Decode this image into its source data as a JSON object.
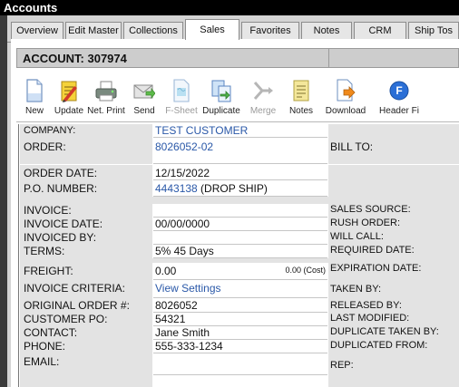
{
  "title": "Accounts",
  "tabs": [
    "Overview",
    "Edit Master",
    "Collections",
    "Sales",
    "Favorites",
    "Notes",
    "CRM",
    "Ship Tos"
  ],
  "active_tab": "Sales",
  "account_title": "ACCOUNT: 307974",
  "toolbar": {
    "new": "New",
    "update": "Update",
    "net_print": "Net. Print",
    "send": "Send",
    "fsheet": "F-Sheet",
    "duplicate": "Duplicate",
    "merge": "Merge",
    "notes": "Notes",
    "download": "Download",
    "header": "Header Fi"
  },
  "form": {
    "company_label": "COMPANY:",
    "company_value": "TEST CUSTOMER",
    "order_label": "ORDER:",
    "order_value": "8026052-02",
    "bill_to_label": "BILL TO:",
    "order_date_label": "ORDER DATE:",
    "order_date_value": "12/15/2022",
    "po_label": "P.O. NUMBER:",
    "po_value_link": "4443138",
    "po_value_text": " (DROP SHIP)",
    "invoice_label": "INVOICE:",
    "invoice_value": "",
    "sales_source_label": "SALES SOURCE:",
    "invoice_date_label": "INVOICE DATE:",
    "invoice_date_value": "00/00/0000",
    "rush_order_label": "RUSH ORDER:",
    "invoiced_by_label": "INVOICED BY:",
    "invoiced_by_value": "",
    "will_call_label": "WILL CALL:",
    "terms_label": "TERMS:",
    "terms_value": "5% 45 Days",
    "required_date_label": "REQUIRED DATE:",
    "freight_label": "FREIGHT:",
    "freight_value": "0.00",
    "freight_cost": "0.00 (Cost)",
    "expiration_date_label": "EXPIRATION DATE:",
    "invoice_criteria_label": "INVOICE CRITERIA:",
    "invoice_criteria_value": "View Settings",
    "taken_by_label": "TAKEN BY:",
    "original_order_label": "ORIGINAL ORDER #:",
    "original_order_value": "8026052",
    "released_by_label": "RELEASED BY:",
    "customer_po_label": "CUSTOMER PO:",
    "customer_po_value": "54321",
    "last_modified_label": "LAST MODIFIED:",
    "contact_label": "CONTACT:",
    "contact_value": "Jane Smith",
    "duplicate_taken_by_label": "DUPLICATE TAKEN BY:",
    "phone_label": "PHONE:",
    "phone_value": "555-333-1234",
    "duplicated_from_label": "DUPLICATED FROM:",
    "email_label": "EMAIL:",
    "email_value": "",
    "rep_label": "REP:"
  },
  "icons": {
    "new": "new-document-icon",
    "update": "update-notepad-icon",
    "net_print": "printer-icon",
    "send": "send-envelope-icon",
    "fsheet": "fsheet-document-icon",
    "duplicate": "duplicate-icon",
    "merge": "merge-icon",
    "notes": "notes-icon",
    "download": "download-icon",
    "header": "header-file-icon"
  }
}
